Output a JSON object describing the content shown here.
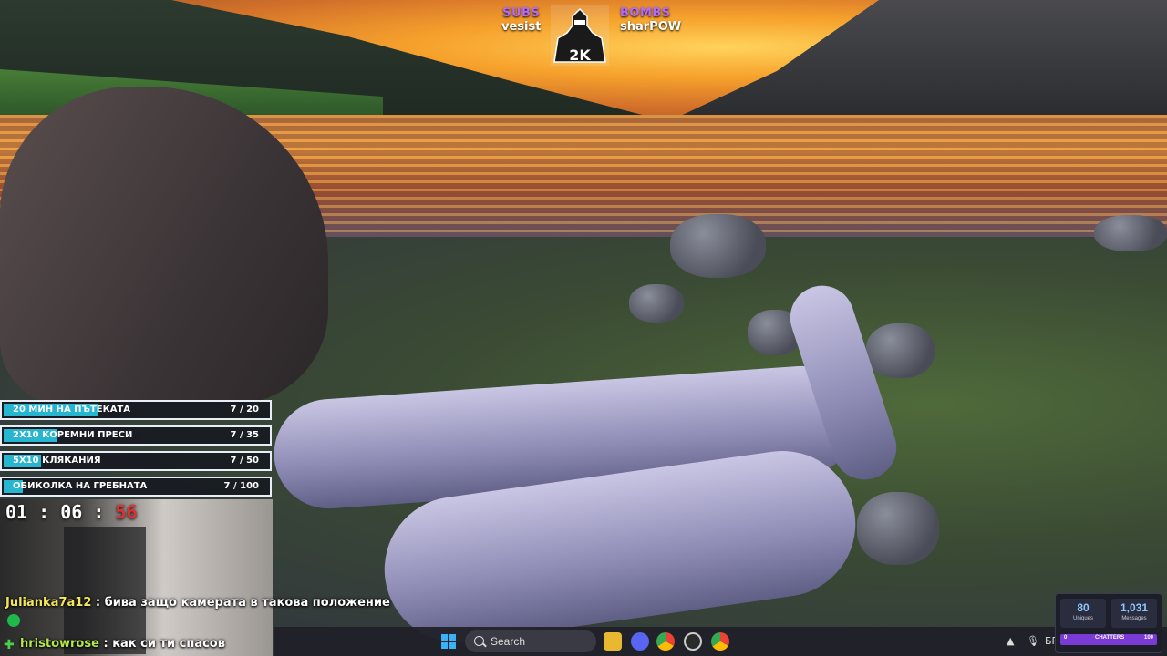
{
  "header": {
    "subs_label": "SUBS",
    "subs_value": "vesist",
    "bombs_label": "BOMBS",
    "bombs_value": "sharPOW",
    "logo_text": "2K"
  },
  "goals": [
    {
      "name": "20 МИН НА ПЪТЕКАТА",
      "count": "7 / 20",
      "progress": 0.35
    },
    {
      "name": "2X10 КОРЕМНИ ПРЕСИ",
      "count": "7 / 35",
      "progress": 0.2
    },
    {
      "name": "5X10 КЛЯКАНИЯ",
      "count": "7 / 50",
      "progress": 0.14
    },
    {
      "name": "ОБИКОЛКА НА ГРЕБНАТА",
      "count": "7 / 100",
      "progress": 0.07
    }
  ],
  "timer": {
    "hh": "01",
    "mm": "06",
    "ss": "56",
    "sep": ":"
  },
  "chat": [
    {
      "user": "Julianka7a12",
      "sep": " : ",
      "message": "бива защо камерата в такова положение"
    },
    {
      "user": "hristowrose",
      "sep": " : ",
      "message": "как си ти спасов"
    }
  ],
  "taskbar": {
    "search_placeholder": "Search",
    "tray_lang": "БГ"
  },
  "widget": {
    "uniques_value": "80",
    "uniques_label": "Uniques",
    "messages_value": "1,031",
    "messages_label": "Messages",
    "chatters_min": "0",
    "chatters_label": "CHATTERS",
    "chatters_max": "100"
  },
  "colors": {
    "goal_fill": "#27b6cf",
    "timer_seconds": "#e03030",
    "stat_label": "#b26bff"
  }
}
